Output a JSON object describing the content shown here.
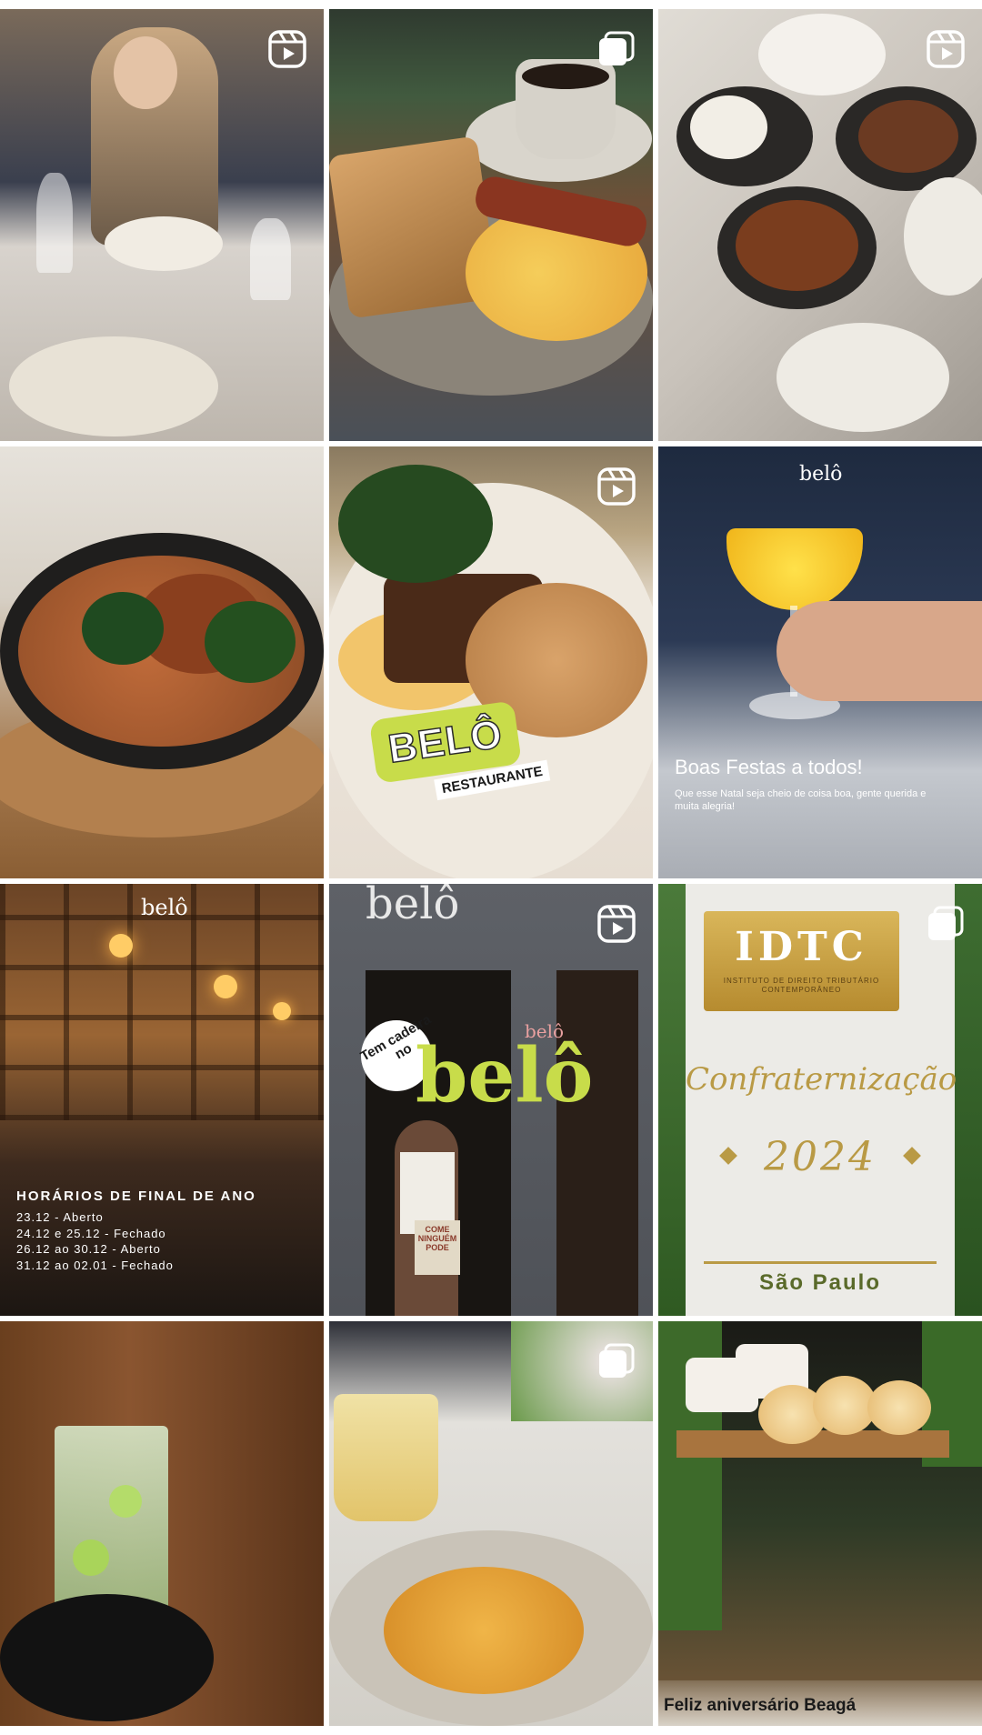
{
  "grid": {
    "tiles": [
      {
        "kind": "reel",
        "alt": "woman dining"
      },
      {
        "kind": "multi",
        "alt": "toast and bacon"
      },
      {
        "kind": "reel",
        "alt": "table of dishes"
      },
      {
        "kind": "none",
        "alt": "skillet rice"
      },
      {
        "kind": "reel",
        "alt": "beef dish"
      },
      {
        "kind": "none",
        "alt": "cocktail"
      },
      {
        "kind": "none",
        "alt": "restaurant interior"
      },
      {
        "kind": "reel",
        "alt": "storefront"
      },
      {
        "kind": "multi",
        "alt": "IDTC invitation"
      },
      {
        "kind": "none",
        "alt": "caipirinha"
      },
      {
        "kind": "multi",
        "alt": "shrimp pasta"
      },
      {
        "kind": "none",
        "alt": "cheese bread"
      }
    ]
  },
  "tile5": {
    "brand": "BELÔ",
    "sub": "RESTAURANTE"
  },
  "tile6": {
    "logo": "belô",
    "title": "Boas Festas a todos!",
    "body": "Que esse Natal seja cheio de coisa boa, gente querida e muita alegria!"
  },
  "tile7": {
    "logo": "belô",
    "heading": "HORÁRIOS DE FINAL DE ANO",
    "lines": [
      "23.12  - Aberto",
      "24.12 e 25.12  - Fechado",
      "26.12 ao 30.12 - Aberto",
      "31.12 ao 02.01 - Fechado"
    ]
  },
  "tile8": {
    "sign": "belô",
    "curve": "Tem cadeira no",
    "big": "belô",
    "small": "belô",
    "bag": "COME\nNINGUÉM\nPODE"
  },
  "tile9": {
    "org": "IDTC",
    "orgsub": "INSTITUTO DE DIREITO TRIBUTÁRIO CONTEMPORÂNEO",
    "event": "Confraternização",
    "year": "2024",
    "city": "São Paulo"
  },
  "tile12": {
    "text": "Feliz aniversário Beagá"
  },
  "colors": {
    "accent": "#c8dc4a",
    "gold": "#c9a84a",
    "olive": "#5a6a2a"
  }
}
